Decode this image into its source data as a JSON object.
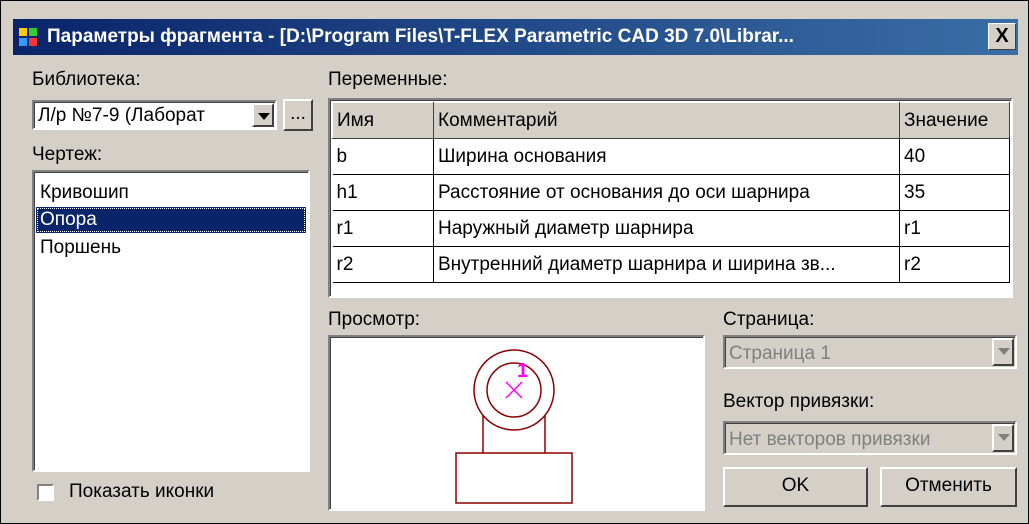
{
  "window": {
    "title": "Параметры фрагмента - [D:\\Program Files\\T-FLEX Parametric CAD 3D 7.0\\Librar...",
    "close_label": "X"
  },
  "library": {
    "label": "Библиотека:",
    "selected": "Л/р №7-9 (Лаборат",
    "browse_label": "..."
  },
  "drawing": {
    "label": "Чертеж:",
    "items": [
      "Кривошип",
      "Опора",
      "Поршень"
    ],
    "selected_index": 1
  },
  "show_icons": {
    "label": "Показать иконки",
    "checked": false
  },
  "variables": {
    "label": "Переменные:",
    "columns": [
      "Имя",
      "Комментарий",
      "Значение"
    ],
    "rows": [
      {
        "name": "b",
        "comment": "Ширина основания",
        "value": "40"
      },
      {
        "name": "h1",
        "comment": "Расстояние от основания до оси шарнира",
        "value": "35"
      },
      {
        "name": "r1",
        "comment": "Наружный диаметр шарнира",
        "value": "r1"
      },
      {
        "name": "r2",
        "comment": "Внутренний диаметр шарнира и ширина зв...",
        "value": "r2"
      }
    ]
  },
  "preview": {
    "label": "Просмотр:",
    "marker_text": "1",
    "line_color": "#8b0000",
    "marker_color": "#ff00ff"
  },
  "page": {
    "label": "Страница:",
    "selected": "Страница 1"
  },
  "anchor": {
    "label": "Вектор привязки:",
    "selected": "Нет векторов привязки"
  },
  "buttons": {
    "ok": "OK",
    "cancel": "Отменить"
  }
}
